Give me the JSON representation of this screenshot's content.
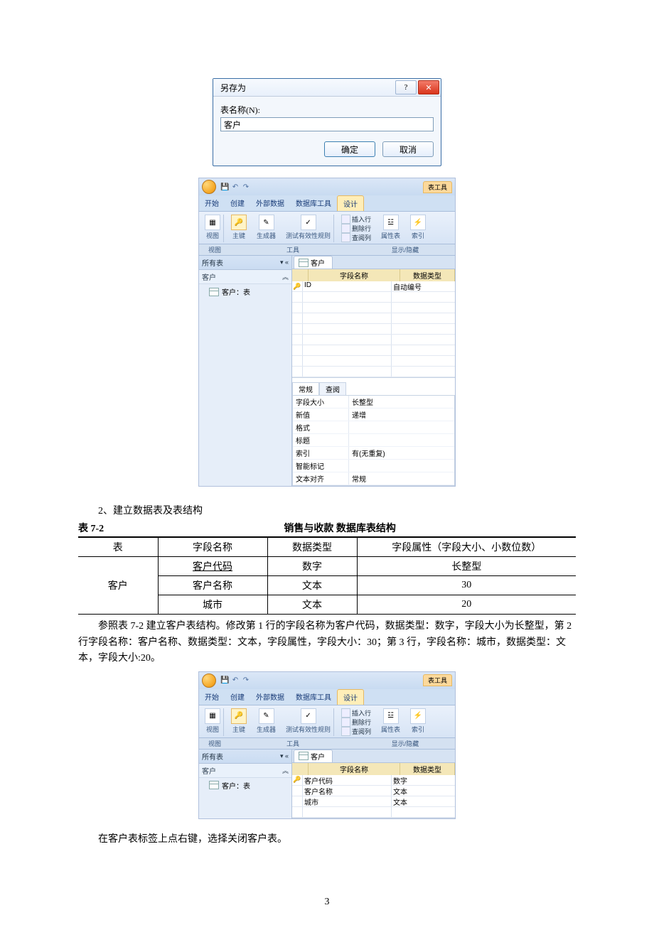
{
  "saveAs": {
    "title": "另存为",
    "label": "表名称(N):",
    "value": "客户",
    "ok": "确定",
    "cancel": "取消",
    "help": "?",
    "close": "✕"
  },
  "access1": {
    "tableTools": "表工具",
    "tabs": {
      "home": "开始",
      "create": "创建",
      "external": "外部数据",
      "dbtools": "数据库工具",
      "design": "设计"
    },
    "ribbon": {
      "view": "视图",
      "pk": "主键",
      "builder": "生成器",
      "test": "测试有效性规则",
      "insertRow": "插入行",
      "deleteRow": "删除行",
      "lookupCol": "查阅列",
      "propSheet": "属性表",
      "indexes": "索引",
      "grpView": "视图",
      "grpTools": "工具",
      "grpShowHide": "显示/隐藏"
    },
    "nav": {
      "header": "所有表",
      "cat": "客户",
      "item": "客户：表"
    },
    "doc": {
      "tab": "客户",
      "colField": "字段名称",
      "colType": "数据类型",
      "rows": [
        {
          "key": true,
          "name": "ID",
          "type": "自动编号"
        }
      ]
    },
    "props": {
      "tabGeneral": "常规",
      "tabLookup": "查阅",
      "rows": [
        {
          "k": "字段大小",
          "v": "长整型"
        },
        {
          "k": "新值",
          "v": "递增"
        },
        {
          "k": "格式",
          "v": ""
        },
        {
          "k": "标题",
          "v": ""
        },
        {
          "k": "索引",
          "v": "有(无重复)"
        },
        {
          "k": "智能标记",
          "v": ""
        },
        {
          "k": "文本对齐",
          "v": "常规"
        }
      ]
    }
  },
  "body": {
    "line1": "2、建立数据表及表结构",
    "t72left": "表 7-2",
    "t72mid": "销售与收款  数据库表结构",
    "headers": {
      "table": "表",
      "field": "字段名称",
      "type": "数据类型",
      "attr": "字段属性（字段大小、小数位数）"
    },
    "rows": [
      {
        "field": "客户代码",
        "type": "数字",
        "attr": "长整型",
        "underline": true
      },
      {
        "field": "客户名称",
        "type": "文本",
        "attr": "30"
      },
      {
        "field": "城市",
        "type": "文本",
        "attr": "20"
      }
    ],
    "tableName": "客户",
    "para1": "参照表 7-2 建立客户表结构。修改第 1 行的字段名称为客户代码，数据类型：数字，字段大小为长整型，第 2 行字段名称：客户名称、数据类型：文本，字段属性，字段大小：30；第 3 行，字段名称：城市，数据类型：文本，字段大小:20。"
  },
  "access2": {
    "rows": [
      {
        "key": true,
        "name": "客户代码",
        "type": "数字"
      },
      {
        "key": false,
        "name": "客户名称",
        "type": "文本"
      },
      {
        "key": false,
        "name": "城市",
        "type": "文本"
      }
    ]
  },
  "closing": "在客户表标签上点右键，选择关闭客户表。",
  "pageNumber": "3"
}
